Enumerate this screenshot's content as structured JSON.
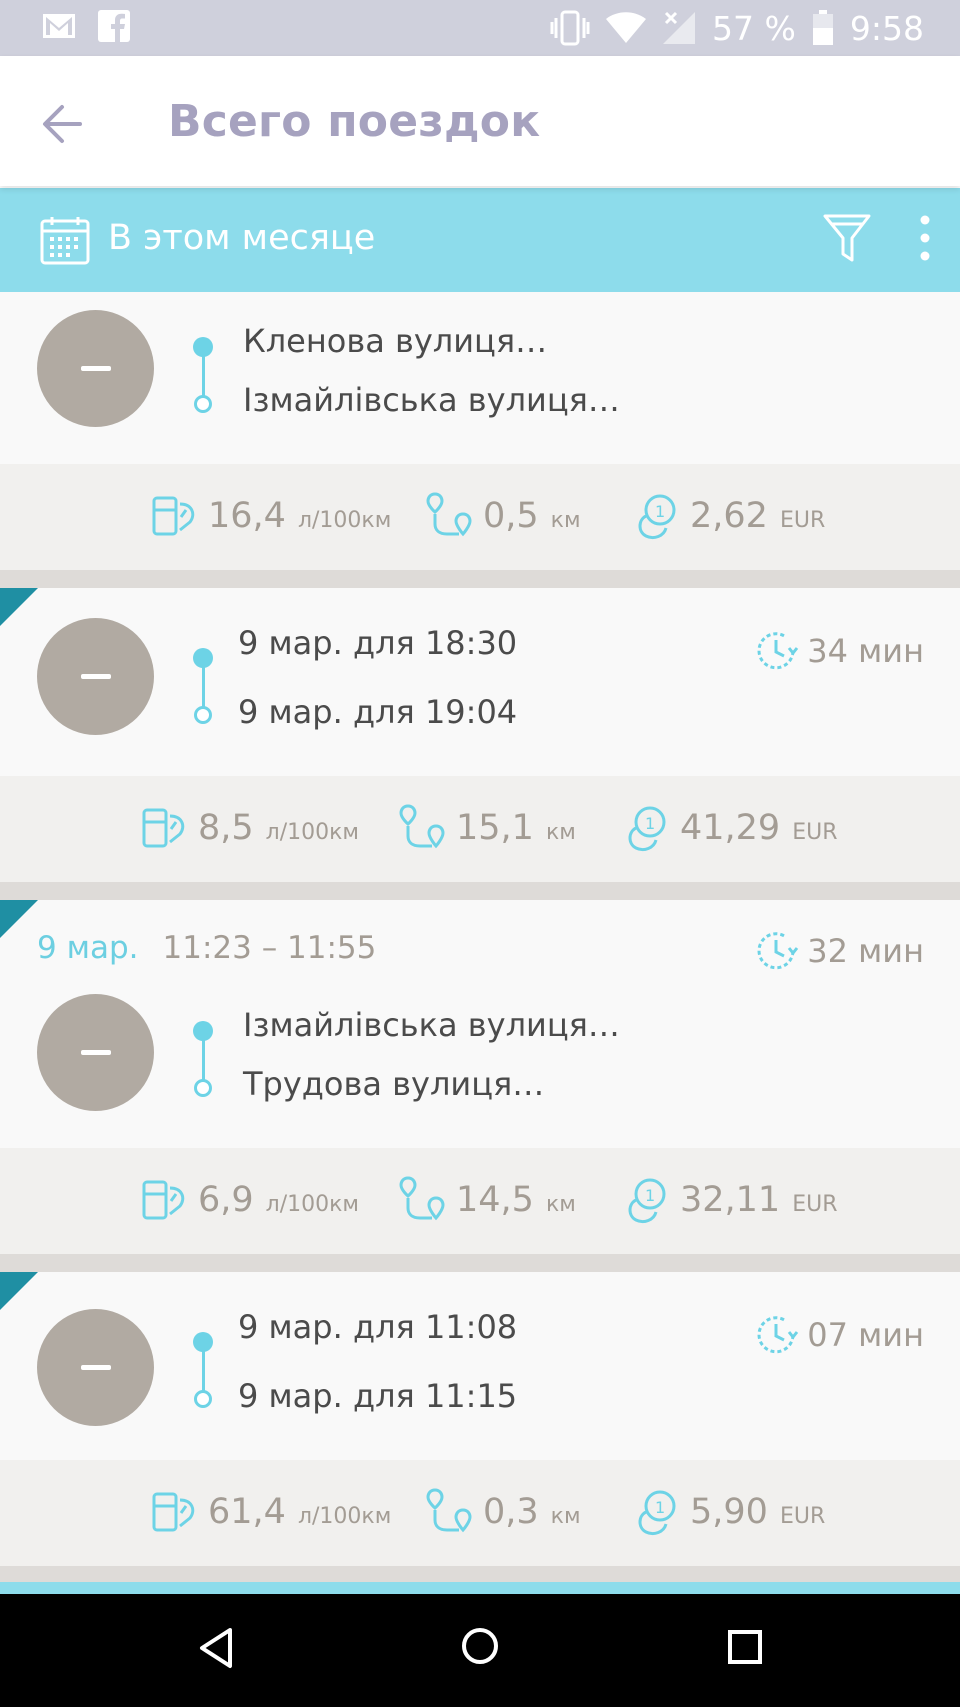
{
  "status_bar": {
    "battery": "57 %",
    "time": "9:58",
    "left_icons": [
      "gmail-icon",
      "facebook-icon"
    ],
    "right_icons": [
      "vibrate-icon",
      "wifi-icon",
      "no-signal-icon",
      "battery-icon"
    ]
  },
  "header": {
    "title": "Всего поездок",
    "back_icon": "arrow-left-icon"
  },
  "filter": {
    "period_label": "В этом месяце",
    "icons": [
      "calendar-icon",
      "filter-icon",
      "more-vert-icon"
    ]
  },
  "colors": {
    "accent": "#8ddceb",
    "title": "#a6a2bf",
    "route": "#6dd3e6",
    "corner": "#1f8fa3",
    "avatar": "#b1aaa2",
    "stat_text": "#a39c94"
  },
  "trips": [
    {
      "from": "Кленова вулиця…",
      "to": "Ізмайлівська вулиця…",
      "fuel": "16,4",
      "fuel_unit": "л/100км",
      "distance": "0,5",
      "distance_unit": "км",
      "cost": "2,62",
      "cost_unit": "EUR"
    },
    {
      "from": "9 мар. для 18:30",
      "to": "9 мар. для 19:04",
      "duration": "34 мин",
      "fuel": "8,5",
      "fuel_unit": "л/100км",
      "distance": "15,1",
      "distance_unit": "км",
      "cost": "41,29",
      "cost_unit": "EUR"
    },
    {
      "date": "9 мар.",
      "time_range": "11:23 – 11:55",
      "duration": "32 мин",
      "from": "Ізмайлівська вулиця…",
      "to": "Трудова вулиця…",
      "fuel": "6,9",
      "fuel_unit": "л/100км",
      "distance": "14,5",
      "distance_unit": "км",
      "cost": "32,11",
      "cost_unit": "EUR"
    },
    {
      "from": "9 мар. для 11:08",
      "to": "9 мар. для 11:15",
      "duration": "07 мин",
      "fuel": "61,4",
      "fuel_unit": "л/100км",
      "distance": "0,3",
      "distance_unit": "км",
      "cost": "5,90",
      "cost_unit": "EUR"
    }
  ],
  "nav_bar": {
    "icons": [
      "nav-back-icon",
      "nav-home-icon",
      "nav-recents-icon"
    ]
  }
}
